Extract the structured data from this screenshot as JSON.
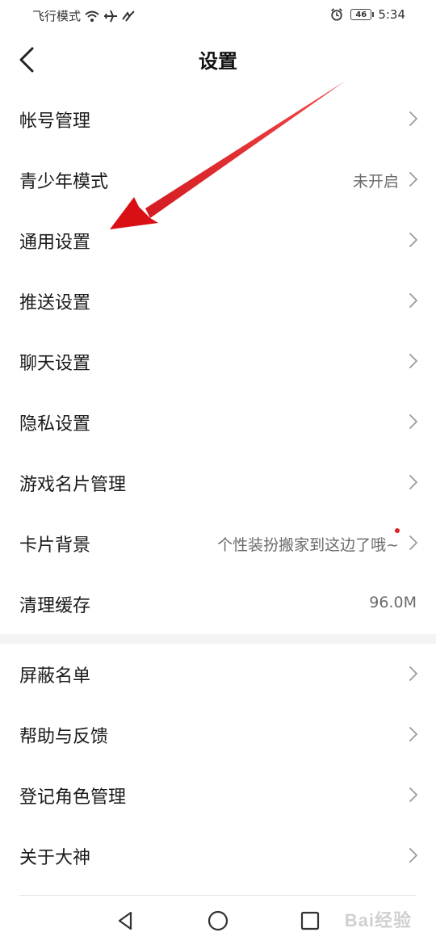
{
  "status_bar": {
    "left_text": "飞行模式",
    "battery_level": "46",
    "time": "5:34",
    "icons": [
      "wifi-icon",
      "airplane-icon",
      "link-icon",
      "alarm-icon",
      "battery-icon"
    ]
  },
  "header": {
    "title": "设置",
    "back_icon": "chevron-left-icon"
  },
  "section1": [
    {
      "label": "帐号管理",
      "value": "",
      "chevron": true,
      "dot": false
    },
    {
      "label": "青少年模式",
      "value": "未开启",
      "chevron": true,
      "dot": false
    },
    {
      "label": "通用设置",
      "value": "",
      "chevron": true,
      "dot": false
    },
    {
      "label": "推送设置",
      "value": "",
      "chevron": true,
      "dot": false
    },
    {
      "label": "聊天设置",
      "value": "",
      "chevron": true,
      "dot": false
    },
    {
      "label": "隐私设置",
      "value": "",
      "chevron": true,
      "dot": false
    },
    {
      "label": "游戏名片管理",
      "value": "",
      "chevron": true,
      "dot": false
    },
    {
      "label": "卡片背景",
      "value": "个性装扮搬家到这边了哦~",
      "chevron": true,
      "dot": true
    },
    {
      "label": "清理缓存",
      "value": "96.0M",
      "chevron": false,
      "dot": false
    }
  ],
  "section2": [
    {
      "label": "屏蔽名单",
      "value": "",
      "chevron": true,
      "dot": false
    },
    {
      "label": "帮助与反馈",
      "value": "",
      "chevron": true,
      "dot": false
    },
    {
      "label": "登记角色管理",
      "value": "",
      "chevron": true,
      "dot": false
    },
    {
      "label": "关于大神",
      "value": "",
      "chevron": true,
      "dot": false
    }
  ],
  "system_nav": [
    "back-triangle-icon",
    "home-circle-icon",
    "recents-square-icon"
  ],
  "watermark": "Bai经验",
  "colors": {
    "arrow_red": "#e8141a",
    "dot_red": "#e0201e",
    "section_gap": "#f4f4f4",
    "value_gray": "#6b6b6b"
  }
}
